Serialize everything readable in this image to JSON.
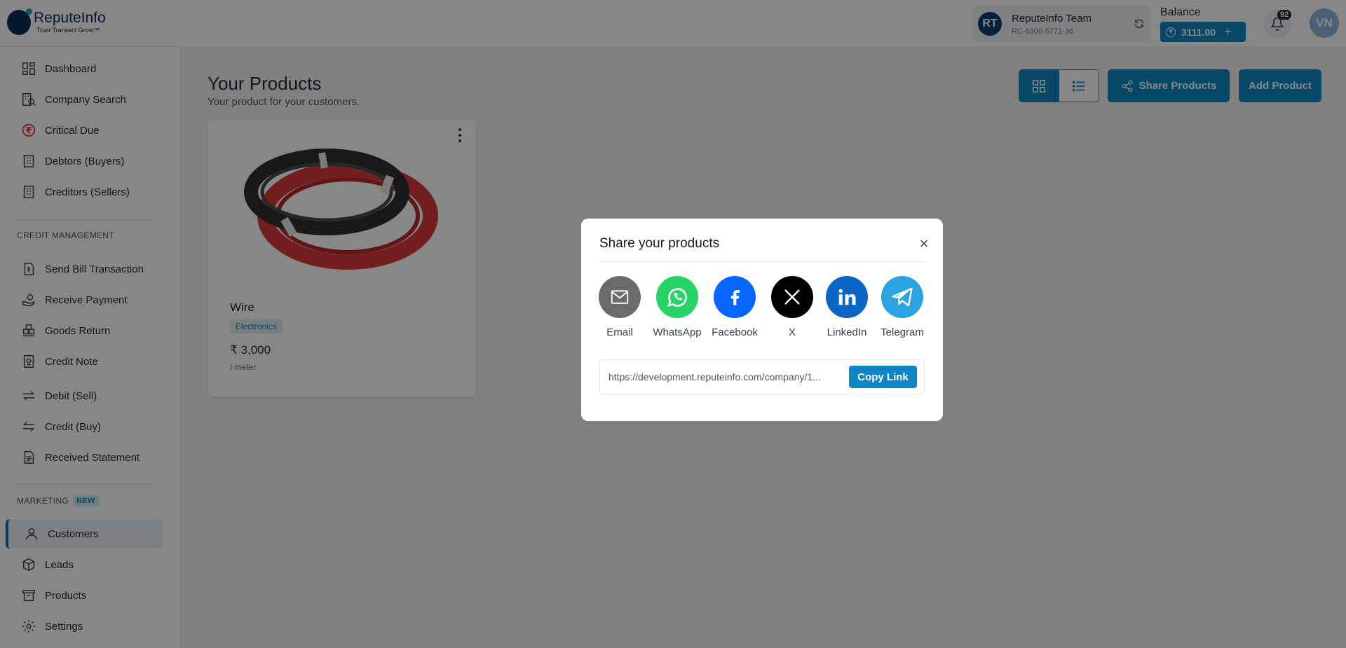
{
  "brand": {
    "name": "ReputeInfo",
    "tagline": "Trust Transact Grow™"
  },
  "account": {
    "initials": "RT",
    "name": "ReputeInfo Team",
    "id": "RC-6300-5771-36"
  },
  "balance": {
    "label": "Balance",
    "amount": "3111.00",
    "currency_symbol": "₹"
  },
  "notifications": {
    "count": "92"
  },
  "user": {
    "initials": "VN"
  },
  "sidebar": {
    "items_top": [
      {
        "label": "Dashboard",
        "icon": "dashboard-icon"
      },
      {
        "label": "Company Search",
        "icon": "company-search-icon"
      },
      {
        "label": "Critical Due",
        "icon": "rupee-circle-icon"
      },
      {
        "label": "Debtors (Buyers)",
        "icon": "building-icon"
      },
      {
        "label": "Creditors (Sellers)",
        "icon": "building-icon"
      }
    ],
    "credit_section": "CREDIT MANAGEMENT",
    "items_credit": [
      {
        "label": "Send Bill Transaction",
        "icon": "bill-icon"
      },
      {
        "label": "Receive Payment",
        "icon": "receive-payment-icon"
      },
      {
        "label": "Goods Return",
        "icon": "goods-return-icon"
      },
      {
        "label": "Credit Note",
        "icon": "credit-note-icon"
      },
      {
        "label": "Debit (Sell)",
        "icon": "debit-arrows-icon"
      },
      {
        "label": "Credit (Buy)",
        "icon": "credit-arrows-icon"
      },
      {
        "label": "Received Statement",
        "icon": "statement-icon"
      }
    ],
    "marketing_section": "MARKETING",
    "marketing_badge": "NEW",
    "items_marketing": [
      {
        "label": "Customers",
        "icon": "user-icon",
        "active": true
      },
      {
        "label": "Leads",
        "icon": "box-icon"
      },
      {
        "label": "Products",
        "icon": "archive-icon"
      },
      {
        "label": "Settings",
        "icon": "gear-icon"
      }
    ]
  },
  "main": {
    "title": "Your Products",
    "subtitle": "Your product for your customers.",
    "share_button": "Share Products",
    "add_button": "Add Product",
    "product": {
      "name": "Wire",
      "category": "Electronics",
      "price": "₹ 3,000",
      "unit": "/ meter"
    }
  },
  "modal": {
    "title": "Share your products",
    "options": [
      {
        "label": "Email",
        "color": "#6b6b6b",
        "icon": "email-icon"
      },
      {
        "label": "WhatsApp",
        "color": "#25d366",
        "icon": "whatsapp-icon"
      },
      {
        "label": "Facebook",
        "color": "#0866ff",
        "icon": "facebook-icon"
      },
      {
        "label": "X",
        "color": "#000000",
        "icon": "x-icon"
      },
      {
        "label": "LinkedIn",
        "color": "#0a66c2",
        "icon": "linkedin-icon"
      },
      {
        "label": "Telegram",
        "color": "#2aa3e0",
        "icon": "telegram-icon"
      }
    ],
    "link": "https://development.reputeinfo.com/company/1...",
    "copy_button": "Copy Link"
  },
  "colors": {
    "accent": "#0f86c4",
    "navy": "#0b2e59"
  }
}
